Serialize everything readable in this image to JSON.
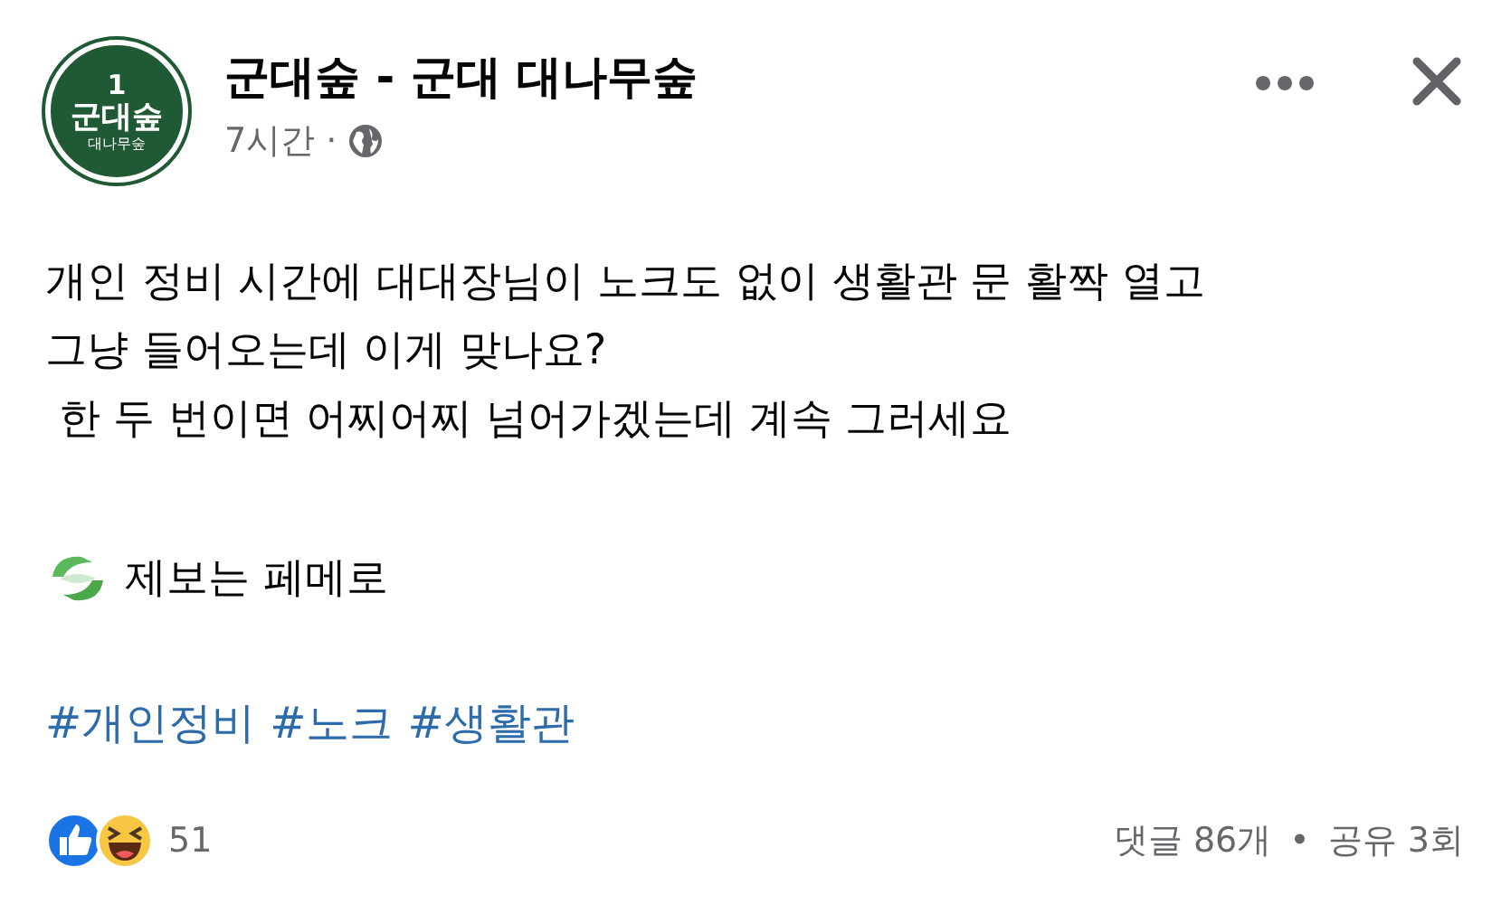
{
  "post": {
    "logo": {
      "number": "1",
      "name": "군대숲",
      "caption": "대나무숲"
    },
    "page_name": "군대숲 - 군대 대나무숲",
    "time": "7시간 ·",
    "public": true,
    "text_lines": [
      "개인 정비 시간에 대대장님이 노크도 없이 생활관 문 활짝 열고",
      "그냥 들어오는데 이게 맞나요?",
      " 한 두 번이면 어찌어찌 넘어가겠는데 계속 그러세요"
    ],
    "tip_line": "제보는 페메로",
    "hashtags": [
      "#개인정비",
      "#노크",
      "#생활관"
    ],
    "reactions": {
      "count": "51"
    },
    "comments": "댓글 86개",
    "separator": "•",
    "shares": "공유 3회"
  }
}
